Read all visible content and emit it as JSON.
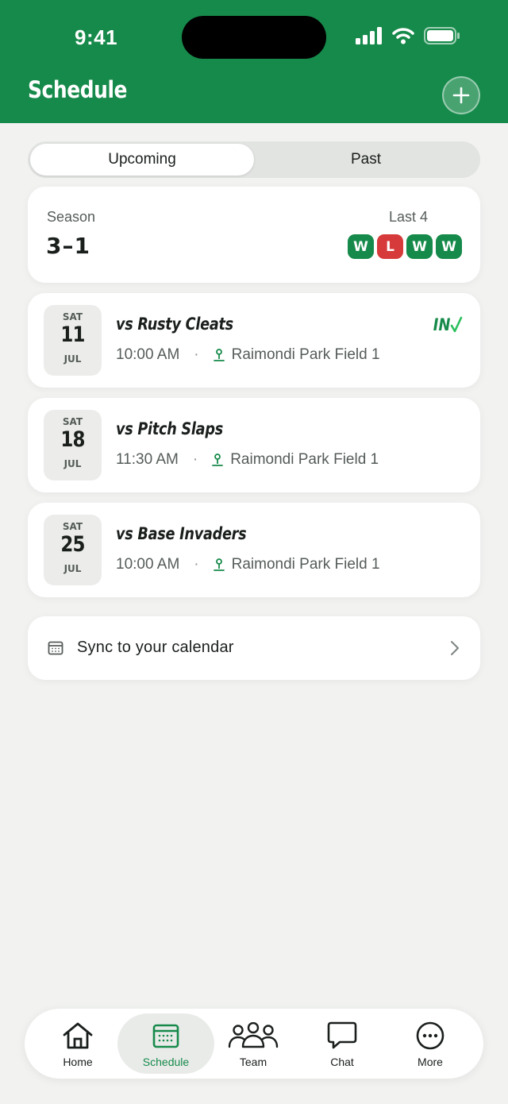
{
  "status": {
    "time": "9:41"
  },
  "header": {
    "title": "Schedule"
  },
  "segments": {
    "upcoming": "Upcoming",
    "past": "Past",
    "selected": "Upcoming"
  },
  "season": {
    "label": "Season",
    "record": "3–1",
    "last_label": "Last 4",
    "last_results": [
      "W",
      "L",
      "W",
      "W"
    ]
  },
  "games": [
    {
      "dow": "SAT",
      "day": "11",
      "month": "JUL",
      "opponent": "vs Rusty Cleats",
      "time": "10:00 AM",
      "location": "Raimondi Park Field 1",
      "rsvp": "IN"
    },
    {
      "dow": "SAT",
      "day": "18",
      "month": "JUL",
      "opponent": "vs Pitch Slaps",
      "time": "11:30 AM",
      "location": "Raimondi Park Field 1",
      "rsvp": ""
    },
    {
      "dow": "SAT",
      "day": "25",
      "month": "JUL",
      "opponent": "vs Base Invaders",
      "time": "10:00 AM",
      "location": "Raimondi Park Field 1",
      "rsvp": ""
    }
  ],
  "meta_separator": "·",
  "sync": {
    "label": "Sync to your calendar"
  },
  "tabs": [
    {
      "label": "Home",
      "icon": "home-icon"
    },
    {
      "label": "Schedule",
      "icon": "calendar-icon"
    },
    {
      "label": "Team",
      "icon": "team-icon"
    },
    {
      "label": "Chat",
      "icon": "chat-icon"
    },
    {
      "label": "More",
      "icon": "more-icon"
    }
  ],
  "active_tab": "Schedule",
  "colors": {
    "brand": "#168a4a",
    "win": "#168a4a",
    "loss": "#d63a3a",
    "background": "#f2f3f1"
  }
}
